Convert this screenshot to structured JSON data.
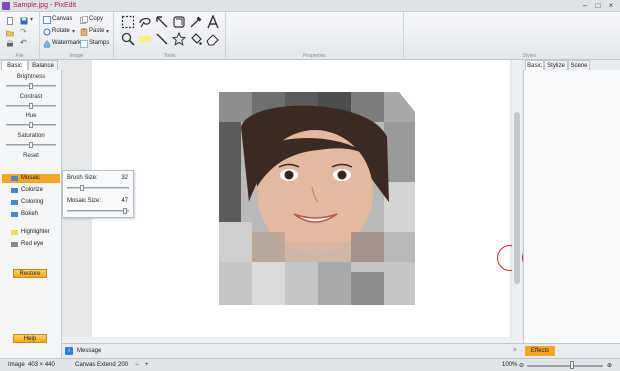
{
  "window": {
    "title": "Sample.jpg - PixEdit"
  },
  "ribbon": {
    "canvas_label": "Canvas",
    "copy_label": "Copy",
    "rotate_label": "Rotate",
    "paste_label": "Paste",
    "watermark_label": "Watermark",
    "stamps_label": "Stamps",
    "group_file": "File",
    "group_image": "Image",
    "group_tools": "Tools",
    "group_properties": "Properties",
    "group_styles": "Styles"
  },
  "left_panel": {
    "tabs": [
      "Basic",
      "Balance"
    ],
    "adjustments": [
      {
        "label": "Brightness",
        "value": 0.5
      },
      {
        "label": "Contrast",
        "value": 0.5
      },
      {
        "label": "Hue",
        "value": 0.5
      },
      {
        "label": "Saturation",
        "value": 0.5
      }
    ],
    "reset_label": "Reset",
    "effects": [
      "Mosaic",
      "Colorize",
      "Coloring",
      "Bokeh",
      "Highlighter",
      "Red eye"
    ],
    "active_effect": "Mosaic",
    "restore_label": "Restore",
    "help_label": "Help"
  },
  "mosaic_popup": {
    "brush_size_label": "Brush Size:",
    "brush_size_value": "32",
    "mosaic_size_label": "Mosaic Size:",
    "mosaic_size_value": "47"
  },
  "message_bar": {
    "label": "Message"
  },
  "right_panel": {
    "tabs": [
      "Basic",
      "Stylize",
      "Scene"
    ],
    "effects_button": "Effects"
  },
  "status": {
    "image_label": "Image",
    "image_size": "403 × 440",
    "canvas_extend_label": "Canvas Extend",
    "canvas_extend_value": "200",
    "zoom": "100%"
  },
  "colors": {
    "accent": "#f5a623",
    "title_text": "#b0203a",
    "cursor_ring": "#d9262b"
  }
}
